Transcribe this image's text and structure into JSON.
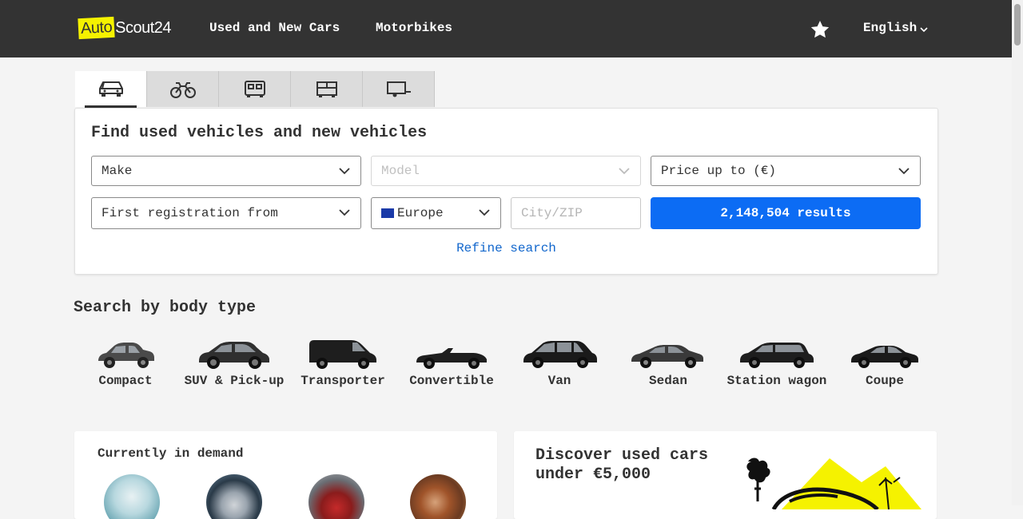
{
  "header": {
    "logo_auto": "Auto",
    "logo_scout": "Scout24",
    "nav": [
      "Used and New Cars",
      "Motorbikes"
    ],
    "language": "English"
  },
  "tabs": [
    {
      "icon": "car-icon",
      "active": true
    },
    {
      "icon": "motorbike-icon",
      "active": false
    },
    {
      "icon": "camper-icon",
      "active": false
    },
    {
      "icon": "truck-icon",
      "active": false
    },
    {
      "icon": "trailer-icon",
      "active": false
    }
  ],
  "search": {
    "title": "Find used vehicles and new vehicles",
    "make": "Make",
    "model": "Model",
    "price": "Price up to (€)",
    "first_registration": "First registration from",
    "country": "Europe",
    "city_placeholder": "City/ZIP",
    "results_button": "2,148,504 results",
    "refine": "Refine search"
  },
  "body_types": {
    "title": "Search by body type",
    "items": [
      "Compact",
      "SUV & Pick-up",
      "Transporter",
      "Convertible",
      "Van",
      "Sedan",
      "Station wagon",
      "Coupe"
    ]
  },
  "demand": {
    "title": "Currently in demand"
  },
  "promo": {
    "line1": "Discover used cars",
    "line2": "under €5,000"
  },
  "colors": {
    "header_bg": "#333333",
    "brand_yellow": "#f5f200",
    "primary_blue": "#0c6cf4",
    "link_blue": "#1166cc"
  }
}
